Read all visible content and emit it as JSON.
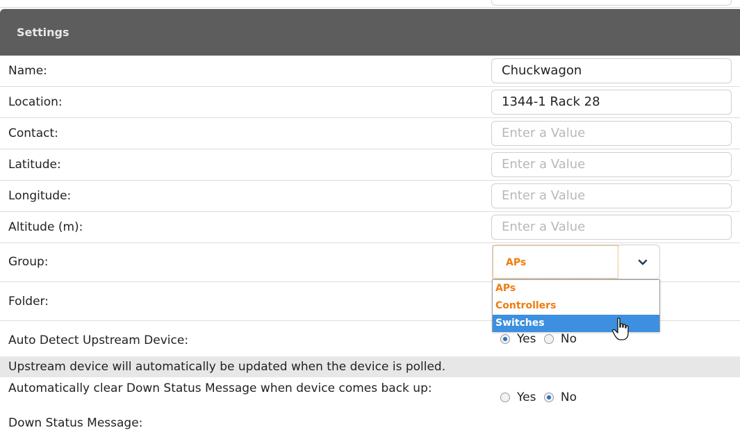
{
  "panel": {
    "title": "Settings"
  },
  "fields": {
    "name": {
      "label": "Name:",
      "value": "Chuckwagon"
    },
    "location": {
      "label": "Location:",
      "value": "1344-1 Rack 28"
    },
    "contact": {
      "label": "Contact:",
      "placeholder": "Enter a Value"
    },
    "latitude": {
      "label": "Latitude:",
      "placeholder": "Enter a Value"
    },
    "longitude": {
      "label": "Longitude:",
      "placeholder": "Enter a Value"
    },
    "altitude": {
      "label": "Altitude (m):",
      "placeholder": "Enter a Value"
    }
  },
  "group": {
    "label": "Group:",
    "selected": "APs",
    "options": [
      "APs",
      "Controllers",
      "Switches"
    ],
    "highlighted": "Switches"
  },
  "folder": {
    "label": "Folder:"
  },
  "auto_detect": {
    "label": "Auto Detect Upstream Device:",
    "yes": "Yes",
    "no": "No",
    "selected": "Yes"
  },
  "upstream_note": "Upstream device will automatically be updated when the device is polled.",
  "auto_clear": {
    "label": "Automatically clear Down Status Message when device comes back up:",
    "yes": "Yes",
    "no": "No",
    "selected": "No"
  },
  "down_status": {
    "label": "Down Status Message:"
  },
  "colors": {
    "header_bg": "#5d5d5d",
    "accent_orange": "#ef7d10",
    "highlight_blue": "#3d8fe0"
  },
  "icons": {
    "select_arrow": "chevron-down-icon",
    "cursor": "hand-pointer-icon"
  }
}
